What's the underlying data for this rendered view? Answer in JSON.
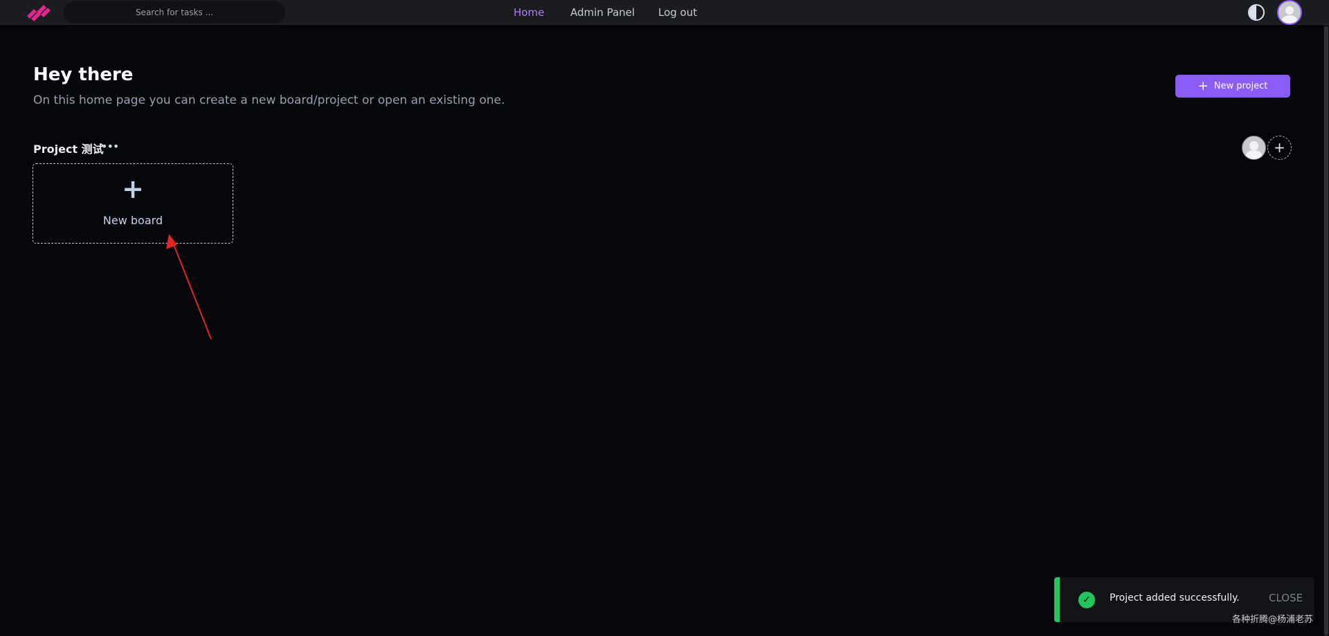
{
  "header": {
    "search_placeholder": "Search for tasks ...",
    "nav": {
      "home": "Home",
      "admin": "Admin Panel",
      "logout": "Log out"
    }
  },
  "main": {
    "title": "Hey there",
    "subtitle": "On this home page you can create a new board/project or open an existing one.",
    "new_project_label": "New project",
    "project": {
      "name": "Project 测试",
      "menu_icon": "ellipsis-icon"
    },
    "new_board_label": "New board"
  },
  "toast": {
    "message": "Project added successfully.",
    "close_label": "CLOSE",
    "status_color": "#22c55e"
  },
  "watermark": "各种折腾@杨浦老苏",
  "colors": {
    "accent": "#8b5cf6",
    "nav_active": "#b57bff",
    "annotation_arrow": "#e32626"
  }
}
